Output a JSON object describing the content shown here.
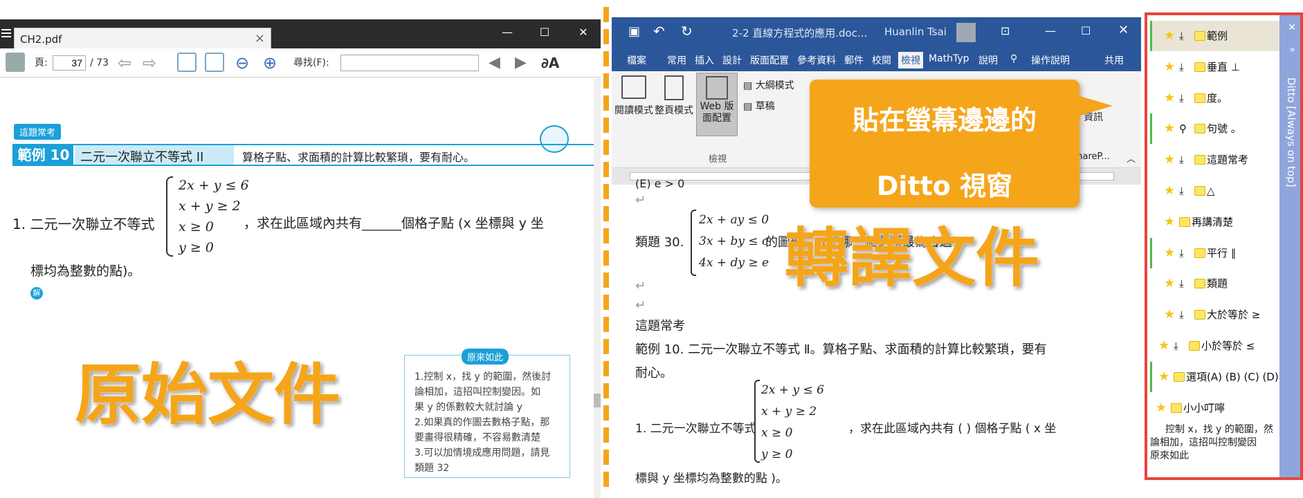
{
  "pdf": {
    "tab_title": "CH2.pdf",
    "page_label": "頁:",
    "page_current": "37",
    "page_total": "/ 73",
    "find_label": "尋找(F):",
    "tag_top": "這題常考",
    "example_number": "範例 10",
    "example_title": "二元一次聯立不等式 II",
    "example_desc": "算格子點、求面積的計算比較繁瑣，要有耐心。",
    "problem_prefix": "1. 二元一次聯立不等式",
    "inequalities": [
      "2x + y ≤ 6",
      "x + y ≥ 2",
      "x ≥ 0",
      "y ≥ 0"
    ],
    "problem_suffix": "，求在此區域內共有______個格子點 (x 坐標與 y 坐",
    "problem_line2": "標均為整數的點)。",
    "solve_tag": "解",
    "note_tag": "原來如此",
    "note_lines": [
      "1.控制 x，找 y 的範圍，然後討",
      "論相加，這招叫控制變因。如",
      "果 y 的係數較大就討論 y",
      "2.如果真的作圖去數格子點，那",
      "要畫得很精確，不容易數清楚",
      "3.可以加情境成應用問題，請見",
      "類題 32"
    ],
    "overlay_label": "原始文件"
  },
  "word": {
    "title": "2-2 直線方程式的應用.doc...",
    "user": "Huanlin Tsai",
    "tabs": [
      "檔案",
      "常用",
      "插入",
      "設計",
      "版面配置",
      "參考資料",
      "郵件",
      "校閱",
      "檢視",
      "MathTyp",
      "說明",
      "操作說明",
      "共用"
    ],
    "ribbon_buttons": [
      "閱讀模式",
      "整頁模式",
      "Web 版面配置",
      "大綱模式",
      "草稿"
    ],
    "ribbon_right": [
      "資訊",
      "ShareP..."
    ],
    "ribbon_group_label": "檢視",
    "doc_lines": [
      "(E) e > 0",
      "類題 30.",
      "的圖形，以下哪一個選項最為合適？",
      "這題常考",
      "範例 10. 二元一次聯立不等式 Ⅱ。算格子點、求面積的計算比較繁瑣，要有",
      "耐心。",
      "1. 二元一次聯立不等式",
      "，求在此區域內共有 ( ) 個格子點 ( x 坐",
      "標與 y 坐標均為整數的點 )。"
    ],
    "word_system1": [
      "2x + ay ≤ 0",
      "3x + by ≤ c",
      "4x + dy ≥ e"
    ],
    "word_system2": [
      "2x + y ≤ 6",
      "x + y ≥ 2",
      "x ≥ 0",
      "y ≥ 0"
    ],
    "callout_line1": "貼在螢幕邊邊的",
    "callout_line2": "Ditto 視窗",
    "overlay_label": "轉譯文件"
  },
  "ditto": {
    "strip_title": "Ditto [Always on top]",
    "items": [
      {
        "label": "範例"
      },
      {
        "label": "垂直 ⊥"
      },
      {
        "label": "度。"
      },
      {
        "label": "句號 。"
      },
      {
        "label": "這題常考"
      },
      {
        "label": "△"
      },
      {
        "label": "再講清楚"
      },
      {
        "label": "平行 ∥"
      },
      {
        "label": "類題"
      },
      {
        "label": "大於等於 ≥"
      },
      {
        "label": "小於等於 ≤"
      },
      {
        "label": "選項(A) (B) (C) (D)"
      },
      {
        "label": "小小叮嚀"
      }
    ],
    "bottom_text_1": "控制 x，找 y 的範圍，然",
    "bottom_text_2": "論相加，這招叫控制變因",
    "bottom_text_3": "原來如此"
  },
  "colors": {
    "accent_orange": "#f5a51a",
    "word_blue": "#2b579a",
    "pdf_blue": "#1aa0d8",
    "ditto_border": "#e8453c"
  }
}
